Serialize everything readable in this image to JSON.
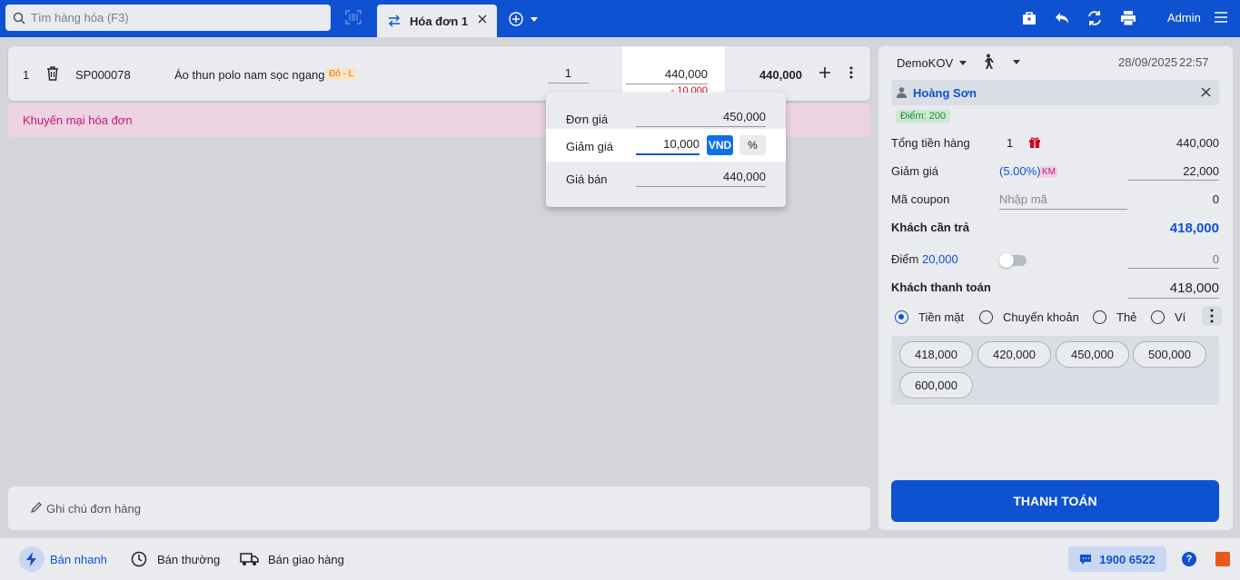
{
  "search": {
    "placeholder": "Tìm hàng hóa (F3)"
  },
  "tab": {
    "label": "Hóa đơn 1"
  },
  "header": {
    "user": "Admin"
  },
  "order": {
    "item": {
      "index": "1",
      "code": "SP000078",
      "name": "Áo thun polo nam sọc ngang",
      "variant": "Đỏ - L",
      "quantity": "1",
      "price": "440,000",
      "discount": "- 10,000",
      "total": "440,000"
    },
    "promo_label": "Khuyến mại hóa đơn",
    "note_placeholder": "Ghi chú đơn hàng"
  },
  "price_popup": {
    "unit_price_label": "Đơn giá",
    "unit_price": "450,000",
    "discount_label": "Giảm giá",
    "discount_value": "10,000",
    "unit_vnd": "VND",
    "unit_pct": "%",
    "sale_price_label": "Giá bán",
    "sale_price": "440,000"
  },
  "checkout": {
    "seller": "DemoKOV",
    "date": "28/09/2025",
    "time": "22:57",
    "customer_name": "Hoàng Sơn",
    "customer_points": "Điểm: 200",
    "subtotal_label": "Tổng tiền hàng",
    "subtotal_count": "1",
    "subtotal": "440,000",
    "discount_label": "Giảm giá",
    "discount_pct": "(5.00%)",
    "discount_tag": "KM",
    "discount": "22,000",
    "coupon_label": "Mã coupon",
    "coupon_placeholder": "Nhập mã",
    "coupon_value": "0",
    "due_label": "Khách cần trả",
    "due": "418,000",
    "points_label": "Điểm",
    "points_value": "20,000",
    "points_amount": "0",
    "paid_label": "Khách thanh toán",
    "paid": "418,000",
    "methods": [
      "Tiền mặt",
      "Chuyển khoản",
      "Thẻ",
      "Ví"
    ],
    "quick_amounts": [
      "418,000",
      "420,000",
      "450,000",
      "500,000",
      "600,000"
    ],
    "pay_button": "THANH TOÁN"
  },
  "footer": {
    "modes": [
      "Bán nhanh",
      "Bán thường",
      "Bán giao hàng"
    ],
    "hotline": "1900 6522",
    "help": "?"
  },
  "colors": {
    "primary": "#0f52d1",
    "promo": "#c2177a",
    "danger": "#d0021b"
  },
  "icons": [
    "search-icon",
    "barcode-scan-icon",
    "swap-icon",
    "close-icon",
    "add-circle-icon",
    "chevron-down-icon",
    "bag-icon",
    "undo-icon",
    "refresh-icon",
    "printer-icon",
    "menu-icon",
    "trash-icon",
    "plus-icon",
    "more-vertical-icon",
    "pencil-icon",
    "walking-icon",
    "user-icon",
    "gift-icon",
    "lightning-icon",
    "clock-icon",
    "truck-icon",
    "chat-icon",
    "help-icon"
  ]
}
